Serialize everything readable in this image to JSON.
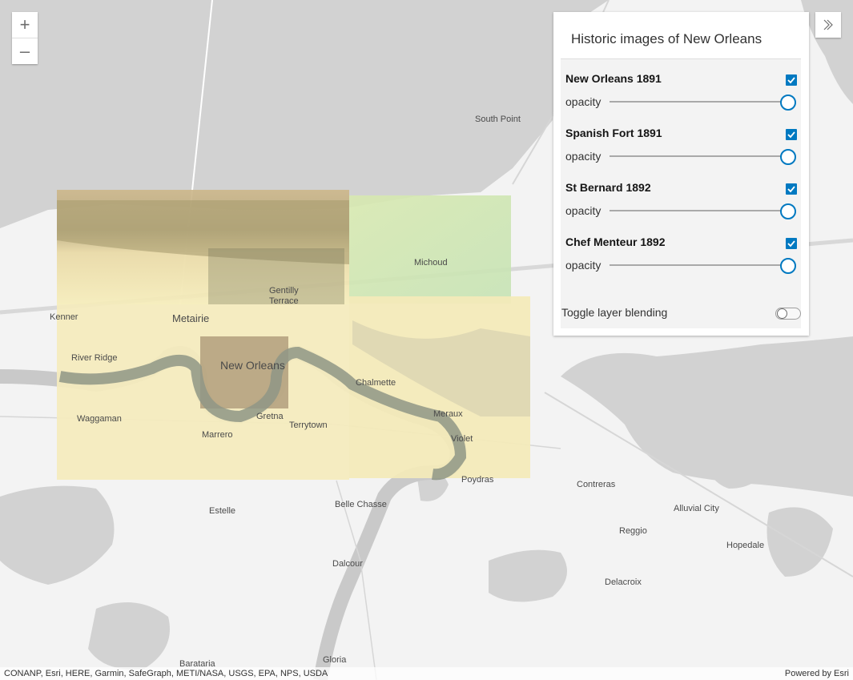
{
  "panel": {
    "title": "Historic images of New Orleans",
    "layers": [
      {
        "name": "New Orleans 1891",
        "checked": true,
        "opacity_label": "opacity",
        "opacity": 1.0
      },
      {
        "name": "Spanish Fort 1891",
        "checked": true,
        "opacity_label": "opacity",
        "opacity": 1.0
      },
      {
        "name": "St Bernard 1892",
        "checked": true,
        "opacity_label": "opacity",
        "opacity": 1.0
      },
      {
        "name": "Chef Menteur 1892",
        "checked": true,
        "opacity_label": "opacity",
        "opacity": 1.0
      }
    ],
    "blend_label": "Toggle layer blending",
    "blend_on": false
  },
  "zoom": {
    "in_label": "+",
    "out_label": "–"
  },
  "map": {
    "places": {
      "south_point": "South Point",
      "michoud": "Michoud",
      "gentilly": "Gentilly",
      "terrace": "Terrace",
      "kenner": "Kenner",
      "metairie": "Metairie",
      "river_ridge": "River Ridge",
      "new_orleans": "New Orleans",
      "chalmette": "Chalmette",
      "waggaman": "Waggaman",
      "gretna": "Gretna",
      "terrytown": "Terrytown",
      "meraux": "Meraux",
      "marrero": "Marrero",
      "violet": "Violet",
      "poydras": "Poydras",
      "contreras": "Contreras",
      "estelle": "Estelle",
      "belle_chasse": "Belle Chasse",
      "alluvial_city": "Alluvial City",
      "reggio": "Reggio",
      "hopedale": "Hopedale",
      "dalcour": "Dalcour",
      "delacroix": "Delacroix",
      "gloria": "Gloria",
      "barataria": "Barataria"
    },
    "colors": {
      "water": "#d2d2d2",
      "land": "#f3f3f3",
      "road": "#ffffff",
      "accent": "#0079c1"
    }
  },
  "attribution": {
    "sources": "CONANP, Esri, HERE, Garmin, SafeGraph, METI/NASA, USGS, EPA, NPS, USDA",
    "powered_by": "Powered by Esri"
  }
}
